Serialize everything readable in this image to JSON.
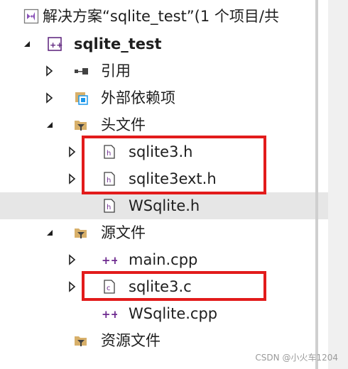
{
  "tree": {
    "solution_label": "解决方案“sqlite_test”(1 个项目/共",
    "project_label": "sqlite_test",
    "references_label": "引用",
    "external_deps_label": "外部依赖项",
    "header_folder_label": "头文件",
    "header_files": [
      "sqlite3.h",
      "sqlite3ext.h",
      "WSqlite.h"
    ],
    "source_folder_label": "源文件",
    "source_files": [
      "main.cpp",
      "sqlite3.c",
      "WSqlite.cpp"
    ],
    "resource_folder_label": "资源文件"
  },
  "selected_item": "WSqlite.h",
  "colors": {
    "highlight": "#e21b1b",
    "selection": "#e6e6e6",
    "folder": "#d8b06a",
    "project_accent": "#6d2a8f"
  },
  "watermark": "CSDN @小火车1204"
}
